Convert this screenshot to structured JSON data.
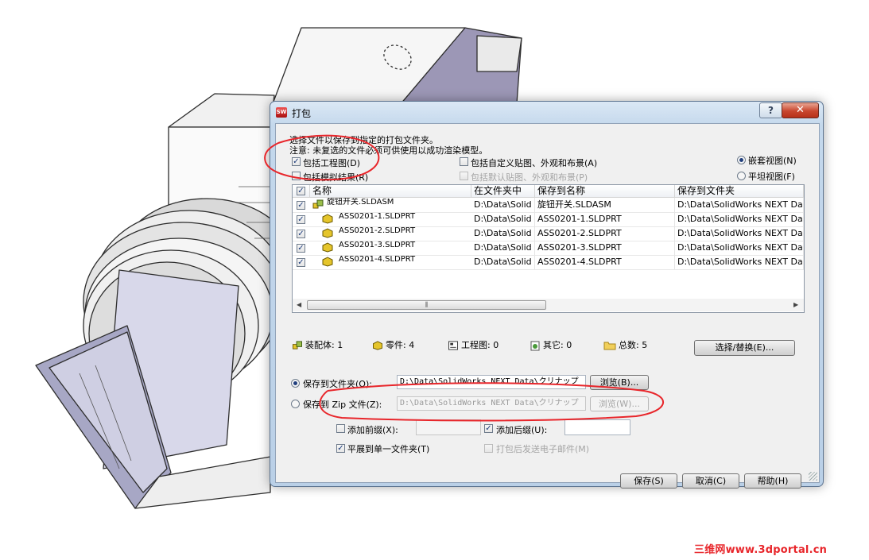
{
  "dialog": {
    "title": "打包",
    "help_label": "?",
    "close_label": "✕",
    "instruction": "选择文件以保存到指定的打包文件夹。",
    "note": "注意: 未复选的文件必须可供使用以成功渲染模型。"
  },
  "options": {
    "include_drawings": "包括工程图(D)",
    "include_simulation": "包括模拟结果(R)",
    "include_custom_decals": "包括自定义贴图、外观和布景(A)",
    "include_default_decals": "包括默认贴图、外观和布景(P)",
    "view_nested": "嵌套视图(N)",
    "view_flat": "平坦视图(F)"
  },
  "list": {
    "columns": [
      "名称",
      "在文件夹中",
      "保存到名称",
      "保存到文件夹"
    ],
    "rows": [
      {
        "name": "旋钮开关.SLDASM",
        "in_folder": "D:\\Data\\Solid",
        "save_name": "旋钮开关.SLDASM",
        "save_folder": "D:\\Data\\SolidWorks NEXT Data",
        "checked": true,
        "type": "assembly"
      },
      {
        "name": "ASS0201-1.SLDPRT",
        "in_folder": "D:\\Data\\Solid",
        "save_name": "ASS0201-1.SLDPRT",
        "save_folder": "D:\\Data\\SolidWorks NEXT Data",
        "checked": true,
        "type": "part"
      },
      {
        "name": "ASS0201-2.SLDPRT",
        "in_folder": "D:\\Data\\Solid",
        "save_name": "ASS0201-2.SLDPRT",
        "save_folder": "D:\\Data\\SolidWorks NEXT Data",
        "checked": true,
        "type": "part"
      },
      {
        "name": "ASS0201-3.SLDPRT",
        "in_folder": "D:\\Data\\Solid",
        "save_name": "ASS0201-3.SLDPRT",
        "save_folder": "D:\\Data\\SolidWorks NEXT Data",
        "checked": true,
        "type": "part"
      },
      {
        "name": "ASS0201-4.SLDPRT",
        "in_folder": "D:\\Data\\Solid",
        "save_name": "ASS0201-4.SLDPRT",
        "save_folder": "D:\\Data\\SolidWorks NEXT Data",
        "checked": true,
        "type": "part"
      }
    ],
    "scroll_thumb_glyph": "⫼"
  },
  "stats": {
    "assemblies": "装配体: 1",
    "parts": "零件: 4",
    "drawings": "工程图: 0",
    "others": "其它: 0",
    "total": "总数: 5",
    "replace_button": "选择/替换(E)..."
  },
  "save": {
    "to_folder_label": "保存到文件夹(O):",
    "folder_path": "D:\\Data\\SolidWorks NEXT Data\\クリナップ",
    "browse_label": "浏览(B)...",
    "to_zip_label": "保存到 Zip 文件(Z):",
    "zip_path": "D:\\Data\\SolidWorks NEXT Data\\クリナップ",
    "browse_zip_label": "浏览(W)...",
    "add_prefix_label": "添加前缀(X):",
    "prefix_value": "",
    "add_suffix_label": "添加后缀(U):",
    "suffix_value": "",
    "flatten_label": "平展到单一文件夹(T)",
    "email_label": "打包后发送电子邮件(M)"
  },
  "buttons": {
    "save": "保存(S)",
    "cancel": "取消(C)",
    "help": "帮助(H)"
  },
  "watermark": "三维网www.3dportal.cn",
  "icons": {
    "app": "solidworks-logo-icon",
    "assembly": "assembly-icon",
    "part": "part-icon",
    "drawing": "drawing-icon",
    "other": "other-file-icon",
    "total": "folder-icon"
  },
  "colors": {
    "annotation": "#e8262b",
    "check": "#1b3b7a",
    "part_yellow": "#e5c52b"
  }
}
